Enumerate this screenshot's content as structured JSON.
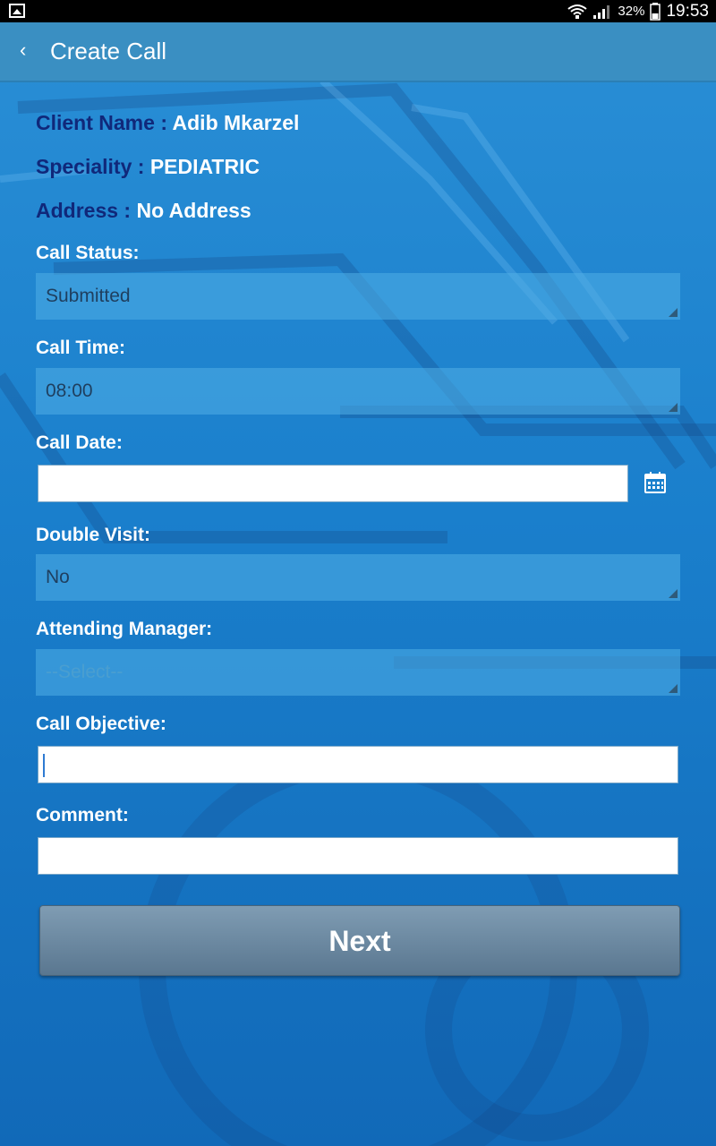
{
  "status_bar": {
    "battery_percent": "32%",
    "time": "19:53"
  },
  "app_bar": {
    "title": "Create Call"
  },
  "client_info": {
    "client_name_label": "Client Name : ",
    "client_name_value": "Adib Mkarzel",
    "speciality_label": "Speciality : ",
    "speciality_value": "PEDIATRIC",
    "address_label": "Address : ",
    "address_value": "No Address"
  },
  "form": {
    "call_status_label": "Call Status:",
    "call_status_value": "Submitted",
    "call_time_label": "Call Time:",
    "call_time_value": "08:00",
    "call_date_label": "Call Date:",
    "call_date_value": "",
    "double_visit_label": "Double Visit:",
    "double_visit_value": "No",
    "attending_manager_label": "Attending Manager:",
    "attending_manager_placeholder": "--Select--",
    "call_objective_label": "Call Objective:",
    "call_objective_value": "",
    "comment_label": "Comment:",
    "comment_value": "",
    "next_label": "Next"
  },
  "icons": {
    "back": "chevron-left-icon",
    "calendar": "calendar-icon",
    "wifi": "wifi-icon",
    "signal": "signal-icon",
    "battery": "battery-icon",
    "notification": "image-notification-icon"
  },
  "colors": {
    "app_bar": "#3a8fc2",
    "label_dark": "#10287a",
    "button": "#6f8ca4"
  }
}
